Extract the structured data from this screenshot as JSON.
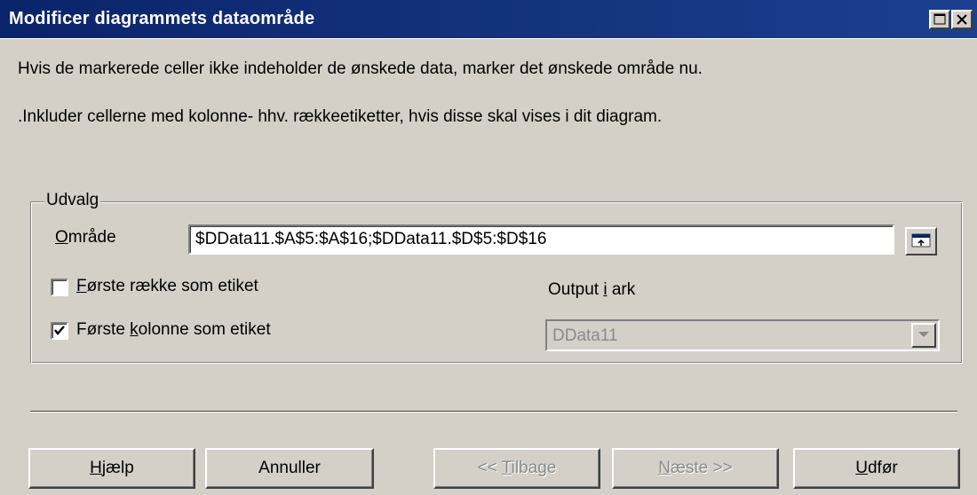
{
  "window": {
    "title": "Modificer diagrammets dataområde"
  },
  "intro": {
    "line1": "Hvis de markerede celler ikke indeholder de ønskede data, marker det ønskede område nu.",
    "line2": ".Inkluder cellerne med kolonne- hhv. rækkeetiketter, hvis disse skal vises i dit diagram."
  },
  "selection": {
    "group_title": "Udvalg",
    "range": {
      "label_mnemonic": "O",
      "label_rest": "mråde",
      "value": "$DData11.$A$5:$A$16;$DData11.$D$5:$D$16"
    },
    "first_row_label": {
      "checked": false,
      "mnemonic": "F",
      "rest": "ørste række som etiket"
    },
    "first_column_label": {
      "checked": true,
      "before": "Første ",
      "mnemonic": "k",
      "after": "olonne som etiket"
    },
    "output": {
      "before": "Output ",
      "mnemonic": "i",
      "after": " ark",
      "value": "DData11",
      "enabled": false
    }
  },
  "buttons": {
    "help": {
      "mnemonic": "H",
      "rest": "jælp"
    },
    "cancel": {
      "label": "Annuller"
    },
    "back": {
      "before": "<< ",
      "mnemonic": "T",
      "after": "ilbage",
      "enabled": false
    },
    "next": {
      "mnemonic": "N",
      "after": "æste >>",
      "enabled": false
    },
    "finish": {
      "mnemonic": "U",
      "after": "dfør"
    }
  },
  "icons": {
    "maximize": "maximize-icon",
    "close": "close-icon",
    "shrink": "shrink-dialog-icon",
    "dropdown": "chevron-down-icon",
    "check": "checkmark-icon"
  },
  "colors": {
    "titlebar": "#0a246a",
    "face": "#d4d0c8",
    "disabled_text": "#8a8a8a"
  }
}
